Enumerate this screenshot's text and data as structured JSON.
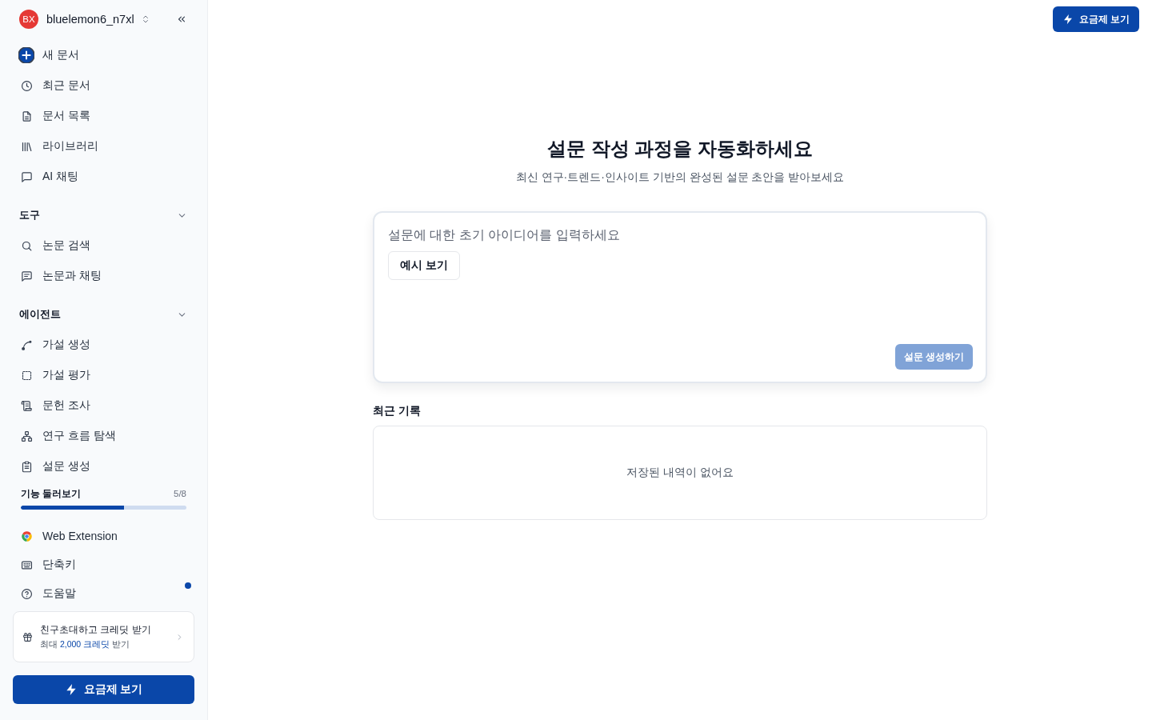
{
  "sidebar": {
    "account": {
      "initials": "BX",
      "name": "bluelemon6_n7xl"
    },
    "nav_items": [
      {
        "label": "새 문서"
      },
      {
        "label": "최근 문서"
      },
      {
        "label": "문서 목록"
      },
      {
        "label": "라이브러리"
      },
      {
        "label": "AI 채팅"
      }
    ],
    "sections": [
      {
        "title": "도구",
        "expanded": true,
        "items": [
          {
            "label": "논문 검색"
          },
          {
            "label": "논문과 채팅"
          }
        ]
      },
      {
        "title": "에이전트",
        "expanded": true,
        "items": [
          {
            "label": "가설 생성"
          },
          {
            "label": "가설 평가"
          },
          {
            "label": "문헌 조사"
          },
          {
            "label": "연구 흐름 탐색"
          },
          {
            "label": "설문 생성"
          }
        ]
      }
    ],
    "tour": {
      "label": "기능 둘러보기",
      "count": "5/8",
      "level": 0.625
    },
    "footer_items": [
      {
        "label": "Web Extension",
        "unread": false
      },
      {
        "label": "단축키",
        "unread": false
      },
      {
        "label": "도움말",
        "unread": true
      }
    ],
    "invite": {
      "title": "친구초대하고 크레딧 받기",
      "subtitle": "최대 **2,000 크레딧** 받기"
    },
    "upgrade_button": "요금제 보기"
  },
  "header": {
    "upgrade_button": "요금제 보기"
  },
  "main": {
    "title": "설문 작성 과정을 자동화하세요",
    "subtitle": "최신 연구·트렌드·인사이트 기반의 완성된 설문 초안을 받아보세요",
    "prompt": {
      "placeholder": "설문에 대한 초기 아이디어를 입력하세요",
      "example_button": "예시 보기",
      "submit_button": {
        "label": "설문 생성하기",
        "disabled": true
      }
    },
    "recent": {
      "title": "최근 기록",
      "empty_message": "저장된 내역이 없어요"
    }
  }
}
